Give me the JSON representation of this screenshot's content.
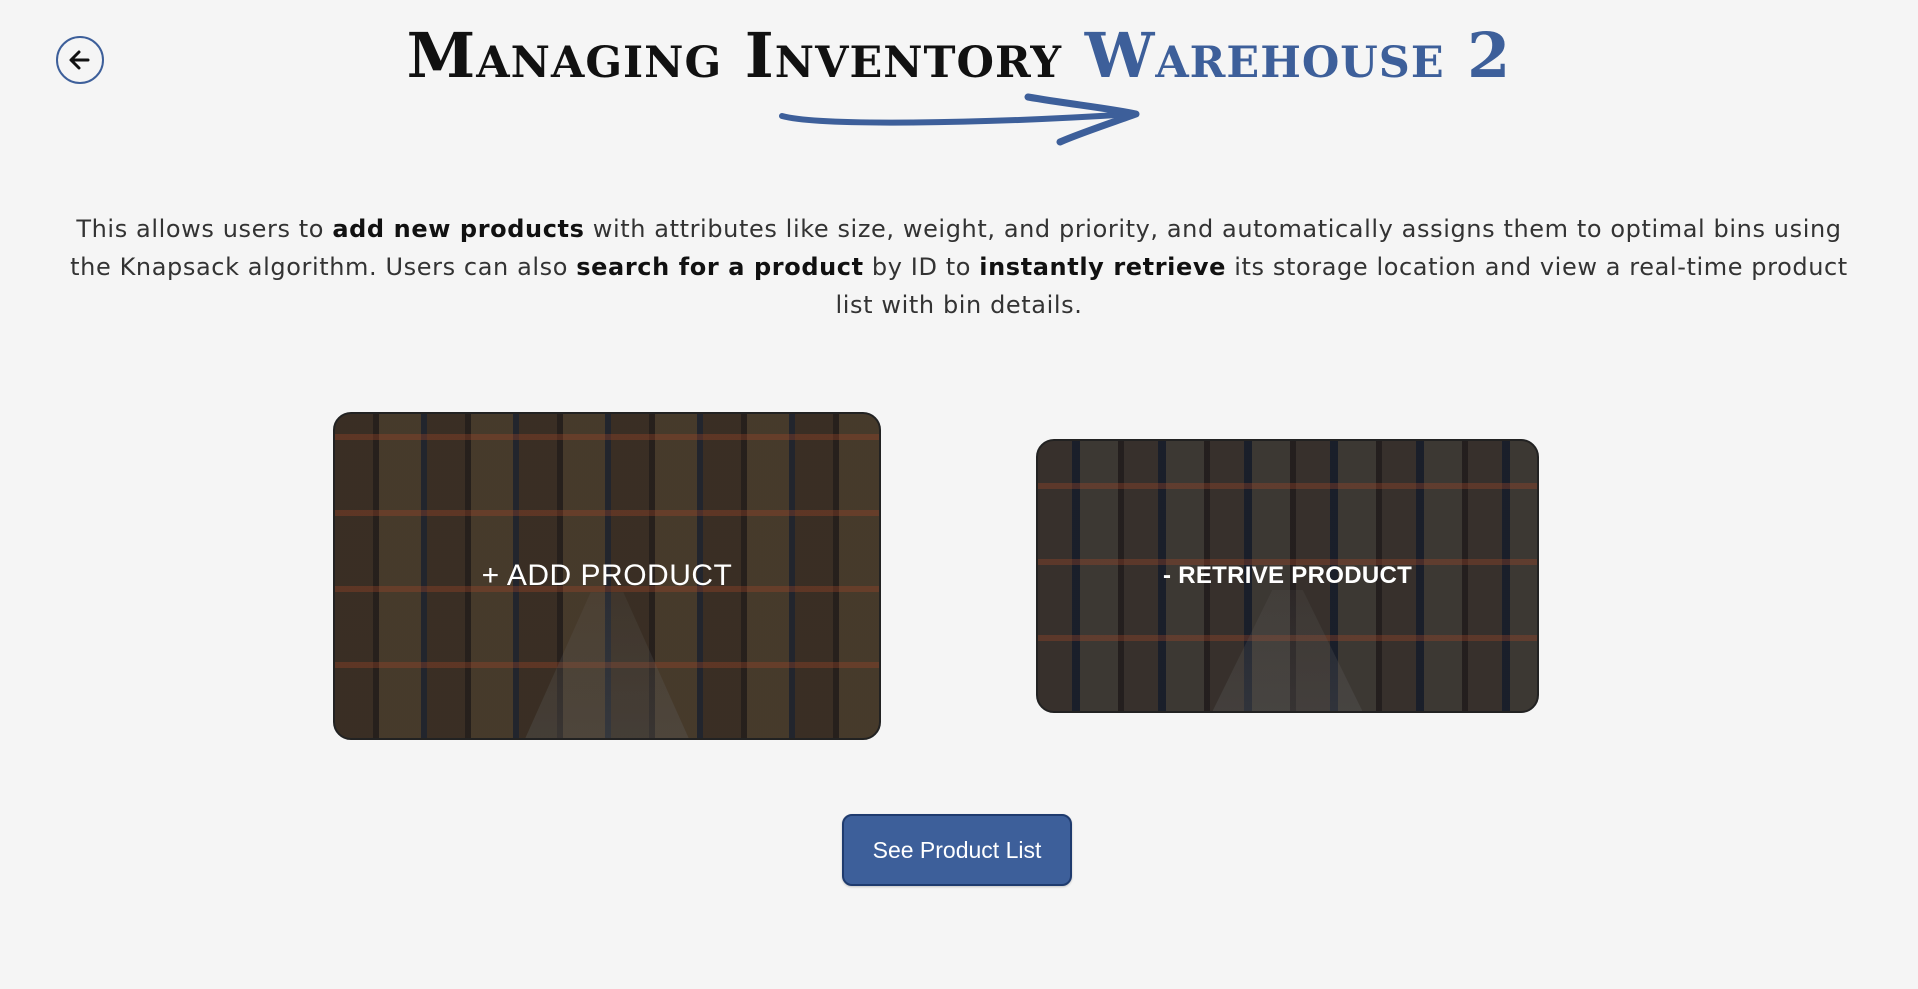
{
  "header": {
    "title_part1": "Managing Inventory",
    "title_part2": "Warehouse 2",
    "back_icon": "arrow-left-icon"
  },
  "description": {
    "t1": "This allows users to ",
    "b1": "add new products",
    "t2": " with attributes like size, weight, and priority, and automatically assigns them to optimal bins using the Knapsack algorithm. Users can also ",
    "b2": "search for a product",
    "t3": " by ID to ",
    "b3": "instantly retrieve",
    "t4": " its storage location and view a real-time product list with bin details."
  },
  "cards": {
    "add_label": "+ ADD PRODUCT",
    "retrieve_label": "- RETRIVE PRODUCT"
  },
  "actions": {
    "product_list_label": "See Product List"
  },
  "colors": {
    "accent": "#3d5f9a",
    "background": "#f5f5f5",
    "text": "#333333"
  }
}
